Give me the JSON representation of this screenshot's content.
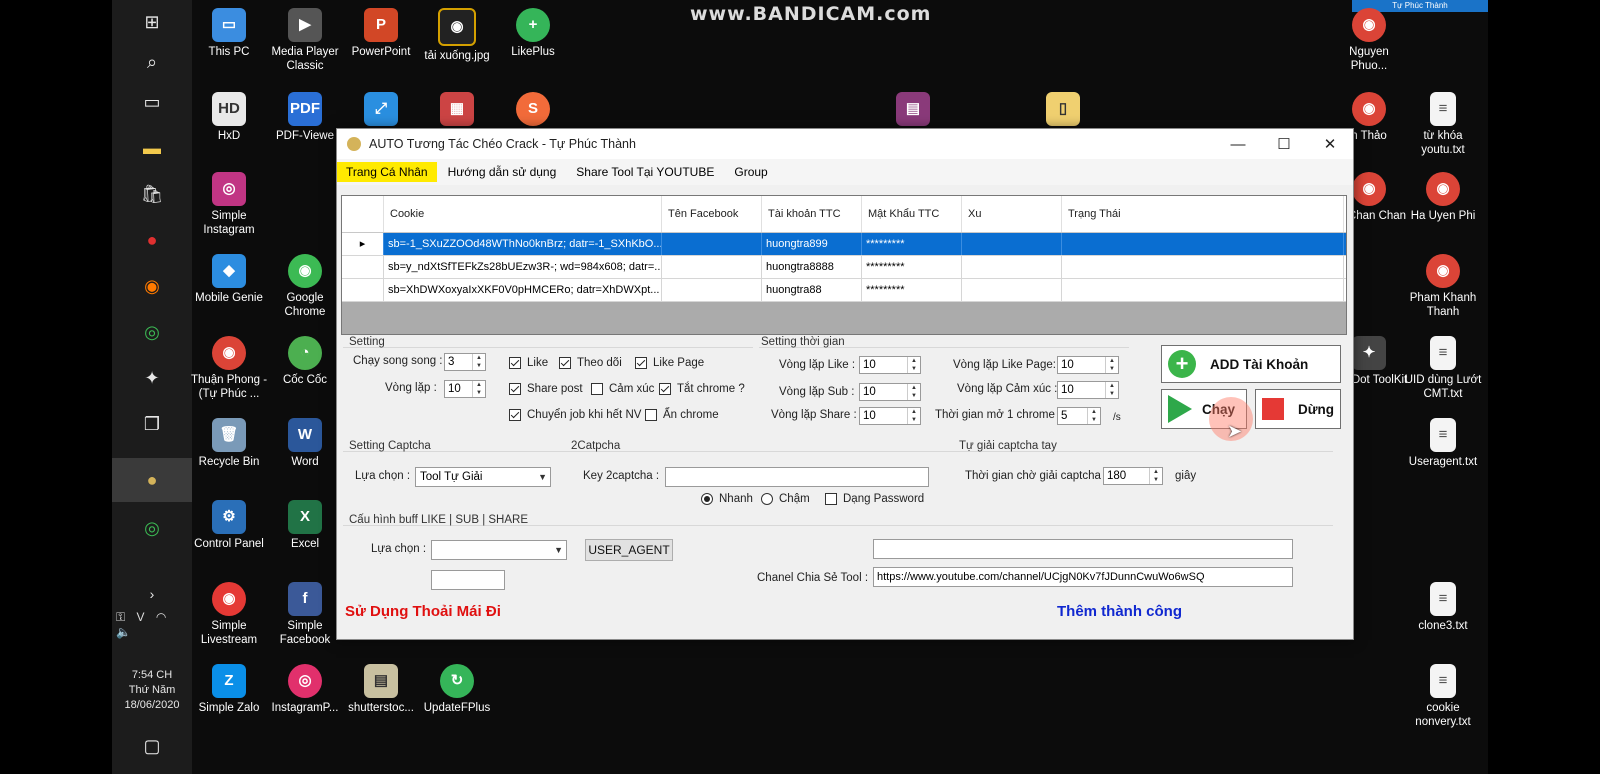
{
  "watermark": "www.BANDICAM.com",
  "top_tag": "Tự Phúc Thành",
  "taskbar": {
    "clock_time": "7:54 CH",
    "clock_day": "Thứ Năm",
    "clock_date": "18/06/2020"
  },
  "desktop_icons": {
    "this_pc": "This PC",
    "media_player": "Media Player Classic",
    "powerpoint": "PowerPoint",
    "taixuong": "tải xuống.jpg",
    "likeplus": "LikePlus",
    "nguyen": "Nguyen Phuo...",
    "hxd": "HxD",
    "pdf": "PDF-Viewe",
    "tuthao": "n Thảo",
    "tukhoa": "từ khóa youtu.txt",
    "simple_instagram": "Simple Instagram",
    "anchan": "an Chan Chan",
    "hauyen": "Ha Uyen Phi",
    "mobile_genie": "Mobile Genie",
    "google_chrome": "Google Chrome",
    "pham": "Pham Khanh Thanh",
    "thuanphong": "Thuận Phong - (Tự Phúc ...",
    "coccoc": "Cốc Cốc",
    "de4dot": "De4Dot ToolKit",
    "uid": "UID dùng Lướt CMT.txt",
    "recycle": "Recycle Bin",
    "word": "Word",
    "useragent": "Useragent.txt",
    "control": "Control Panel",
    "excel": "Excel",
    "livestream": "Simple Livestream",
    "facebook": "Simple Facebook",
    "clone3": "clone3.txt",
    "zalo": "Simple Zalo",
    "instagramp": "InstagramP...",
    "shutterstock": "shutterstoc...",
    "updatefplus": "UpdateFPlus",
    "cookie": "cookie nonvery.txt"
  },
  "window": {
    "title": "AUTO Tương Tác Chéo Crack - Tự Phúc Thành",
    "menu": [
      "Trang Cá Nhân",
      "Hướng dẫn sử dụng",
      "Share Tool Tại YOUTUBE",
      "Group"
    ],
    "grid": {
      "headers": [
        "Cookie",
        "Tên Facebook",
        "Tài khoản TTC",
        "Mật Khẩu TTC",
        "Xu",
        "Trạng Thái"
      ],
      "rows": [
        {
          "cookie": "sb=-1_SXuZZOOd48WThNo0knBrz; datr=-1_SXhKbO...",
          "fb": "",
          "acc": "huongtra899",
          "pass": "*********",
          "xu": "",
          "status": ""
        },
        {
          "cookie": "sb=y_ndXtSfTEFkZs28bUEzw3R-; wd=984x608; datr=...",
          "fb": "",
          "acc": "huongtra8888",
          "pass": "*********",
          "xu": "",
          "status": ""
        },
        {
          "cookie": "sb=XhDWXoxyaIxXKF0V0pHMCERo; datr=XhDWXpt...",
          "fb": "",
          "acc": "huongtra88",
          "pass": "*********",
          "xu": "",
          "status": ""
        }
      ]
    },
    "setting": {
      "title": "Setting",
      "song_song_label": "Chạy song song :",
      "song_song_value": "3",
      "vong_lap_label": "Vòng lặp :",
      "vong_lap_value": "10",
      "like": "Like",
      "theo_doi": "Theo dõi",
      "like_page": "Like Page",
      "share_post": "Share post",
      "cam_xuc": "Cảm xúc",
      "tat_chrome": "Tắt chrome ?",
      "chuyen_job": "Chuyển job khi hết NV",
      "an_chrome": "Ẩn chrome"
    },
    "time": {
      "title": "Setting thời gian",
      "vl_like_label": "Vòng lặp Like :",
      "vl_like_value": "10",
      "vl_sub_label": "Vòng lặp Sub :",
      "vl_sub_value": "10",
      "vl_share_label": "Vòng lặp Share :",
      "vl_share_value": "10",
      "vl_likepage_label": "Vòng lặp Like Page:",
      "vl_likepage_value": "10",
      "vl_camxuc_label": "Vòng lặp Cảm xúc :",
      "vl_camxuc_value": "10",
      "tg_chrome_label": "Thời gian mở 1 chrome :",
      "tg_chrome_value": "5",
      "tg_unit": "/s"
    },
    "buttons": {
      "add": "ADD Tài Khoản",
      "run": "Chạy",
      "stop": "Dừng",
      "user_agent": "USER_AGENT"
    },
    "captcha": {
      "title": "Setting Captcha",
      "select_label": "Lựa chọn :",
      "select_value": "Tool Tự Giải",
      "twocaptcha_title": "2Catpcha",
      "key_label": "Key 2captcha :",
      "key_value": "",
      "nhanh": "Nhanh",
      "cham": "Chậm",
      "dang_password": "Dạng Password",
      "self_title": "Tự giải captcha tay",
      "wait_label": "Thời gian chờ giải captcha :",
      "wait_value": "180",
      "wait_unit": "giây"
    },
    "buff": {
      "title": "Cấu hình buff LIKE | SUB | SHARE",
      "select_label": "Lựa chọn :",
      "select_value": "",
      "small_value": "",
      "top_text_value": "",
      "channel_label": "Chanel Chia Sẻ Tool :",
      "channel_value": "https://www.youtube.com/channel/UCjgN0Kv7fJDunnCwuWo6wSQ"
    },
    "footer_left": "Sử Dụng Thoải Mái Đi",
    "footer_right": "Thêm thành công"
  },
  "colors": {
    "accent_yellow": "#ffea00",
    "selection_blue": "#0a6ed1",
    "footer_red": "#e01010",
    "footer_blue": "#1028d0"
  }
}
